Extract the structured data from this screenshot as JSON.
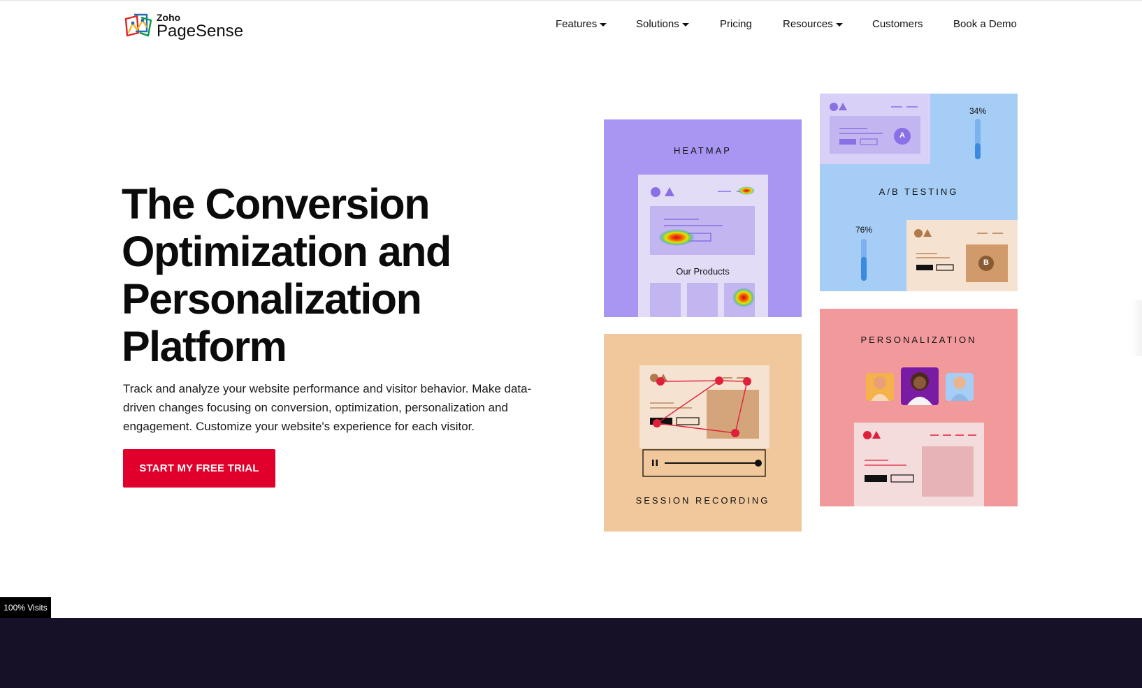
{
  "brand": {
    "company": "Zoho",
    "product": "PageSense"
  },
  "nav": {
    "items": [
      {
        "label": "Features",
        "dropdown": true
      },
      {
        "label": "Solutions",
        "dropdown": true
      },
      {
        "label": "Pricing",
        "dropdown": false
      },
      {
        "label": "Resources",
        "dropdown": true
      },
      {
        "label": "Customers",
        "dropdown": false
      },
      {
        "label": "Book a Demo",
        "dropdown": false
      }
    ]
  },
  "hero": {
    "title_lines": [
      "The Conversion",
      "Optimization and",
      "Personalization",
      "Platform"
    ],
    "description": "Track and analyze your website performance and visitor behavior. Make data-driven changes focusing on conversion, optimization, personalization and engagement. Customize your website's experience for each visitor.",
    "cta_label": "START MY FREE TRIAL"
  },
  "tiles": {
    "heatmap": {
      "label": "HEATMAP",
      "caption": "Our Products"
    },
    "abtest": {
      "label": "A/B TESTING",
      "variant_a": "A",
      "variant_b": "B",
      "percent_a": "34%",
      "percent_b": "76%",
      "fill_a": 0.34,
      "fill_b": 0.76
    },
    "session": {
      "label": "SESSION RECORDING"
    },
    "personalization": {
      "label": "PERSONALIZATION"
    }
  },
  "badge": {
    "visits": "100% Visits"
  },
  "colors": {
    "cta": "#e0002b",
    "heatmap_bg": "#a996f2",
    "abtest_bg": "#a6cdf5",
    "session_bg": "#f0c89b",
    "personalization_bg": "#f2999c",
    "footer_bg": "#171127"
  },
  "icons": [
    "zoho-pagesense-logo-icon",
    "chevron-down-icon",
    "pause-icon"
  ]
}
